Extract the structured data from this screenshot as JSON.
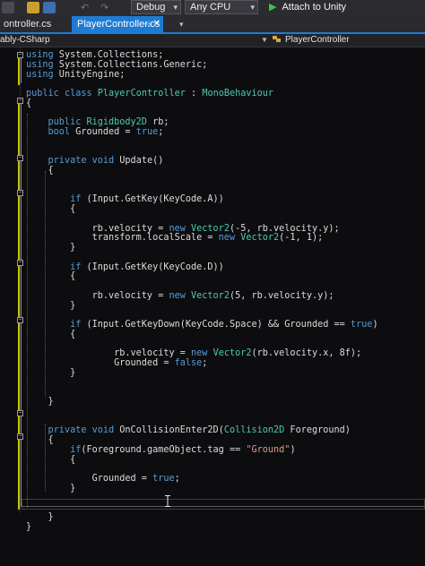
{
  "toolbar": {
    "config_combo": "Debug",
    "platform_combo": "Any CPU",
    "attach_label": "Attach to Unity",
    "icons": [
      "save-all-icon",
      "undo-icon",
      "redo-icon",
      "play-icon"
    ]
  },
  "tabs": [
    {
      "label": "ontroller.cs",
      "active": false
    },
    {
      "label": "PlayerController.cs",
      "active": true
    }
  ],
  "navbar": {
    "project": "ably-CSharp",
    "class_member": "PlayerController"
  },
  "code": {
    "lines": [
      [
        {
          "t": "using",
          "c": "kw"
        },
        {
          "t": " System.Collections;",
          "c": ""
        }
      ],
      [
        {
          "t": "using",
          "c": "kw"
        },
        {
          "t": " System.Collections.Generic;",
          "c": ""
        }
      ],
      [
        {
          "t": "using",
          "c": "kw"
        },
        {
          "t": " UnityEngine;",
          "c": ""
        }
      ],
      [],
      [
        {
          "t": "public",
          "c": "kw"
        },
        {
          "t": " ",
          "c": ""
        },
        {
          "t": "class",
          "c": "kw"
        },
        {
          "t": " ",
          "c": ""
        },
        {
          "t": "PlayerController",
          "c": "ty"
        },
        {
          "t": " : ",
          "c": ""
        },
        {
          "t": "MonoBehaviour",
          "c": "ty"
        }
      ],
      [
        {
          "t": "{",
          "c": ""
        }
      ],
      [],
      [
        {
          "t": "    public ",
          "c": "kw"
        },
        {
          "t": "Rigidbody2D",
          "c": "ty"
        },
        {
          "t": " rb;",
          "c": ""
        }
      ],
      [
        {
          "t": "    bool",
          "c": "kw"
        },
        {
          "t": " Grounded = ",
          "c": ""
        },
        {
          "t": "true",
          "c": "kw"
        },
        {
          "t": ";",
          "c": ""
        }
      ],
      [],
      [],
      [
        {
          "t": "    private ",
          "c": "kw"
        },
        {
          "t": "void",
          "c": "kw"
        },
        {
          "t": " Update()",
          "c": ""
        }
      ],
      [
        {
          "t": "    {",
          "c": ""
        }
      ],
      [],
      [],
      [
        {
          "t": "        if",
          "c": "kw"
        },
        {
          "t": " (Input.GetKey(KeyCode.A))",
          "c": ""
        }
      ],
      [
        {
          "t": "        {",
          "c": ""
        }
      ],
      [],
      [
        {
          "t": "            rb.velocity = ",
          "c": ""
        },
        {
          "t": "new",
          "c": "kw"
        },
        {
          "t": " ",
          "c": ""
        },
        {
          "t": "Vector2",
          "c": "ty"
        },
        {
          "t": "(-5, rb.velocity.y);",
          "c": ""
        }
      ],
      [
        {
          "t": "            transform.localScale = ",
          "c": ""
        },
        {
          "t": "new",
          "c": "kw"
        },
        {
          "t": " ",
          "c": ""
        },
        {
          "t": "Vector2",
          "c": "ty"
        },
        {
          "t": "(-1, 1);",
          "c": ""
        }
      ],
      [
        {
          "t": "        }",
          "c": ""
        }
      ],
      [],
      [
        {
          "t": "        if",
          "c": "kw"
        },
        {
          "t": " (Input.GetKey(KeyCode.D))",
          "c": ""
        }
      ],
      [
        {
          "t": "        {",
          "c": ""
        }
      ],
      [],
      [
        {
          "t": "            rb.velocity = ",
          "c": ""
        },
        {
          "t": "new",
          "c": "kw"
        },
        {
          "t": " ",
          "c": ""
        },
        {
          "t": "Vector2",
          "c": "ty"
        },
        {
          "t": "(5, rb.velocity.y);",
          "c": ""
        }
      ],
      [
        {
          "t": "        }",
          "c": ""
        }
      ],
      [],
      [
        {
          "t": "        if",
          "c": "kw"
        },
        {
          "t": " (Input.GetKeyDown(KeyCode.Space) && Grounded == ",
          "c": ""
        },
        {
          "t": "true",
          "c": "kw"
        },
        {
          "t": ")",
          "c": ""
        }
      ],
      [
        {
          "t": "        {",
          "c": ""
        }
      ],
      [],
      [
        {
          "t": "                rb.velocity = ",
          "c": ""
        },
        {
          "t": "new",
          "c": "kw"
        },
        {
          "t": " ",
          "c": ""
        },
        {
          "t": "Vector2",
          "c": "ty"
        },
        {
          "t": "(rb.velocity.x, 8f);",
          "c": ""
        }
      ],
      [
        {
          "t": "                Grounded = ",
          "c": ""
        },
        {
          "t": "false",
          "c": "kw"
        },
        {
          "t": ";",
          "c": ""
        }
      ],
      [
        {
          "t": "        }",
          "c": ""
        }
      ],
      [],
      [],
      [
        {
          "t": "    }",
          "c": ""
        }
      ],
      [],
      [],
      [
        {
          "t": "    private ",
          "c": "kw"
        },
        {
          "t": "void",
          "c": "kw"
        },
        {
          "t": " OnCollisionEnter2D(",
          "c": ""
        },
        {
          "t": "Collision2D",
          "c": "ty"
        },
        {
          "t": " Foreground)",
          "c": ""
        }
      ],
      [
        {
          "t": "    {",
          "c": ""
        }
      ],
      [
        {
          "t": "        if",
          "c": "kw"
        },
        {
          "t": "(Foreground.gameObject.tag == ",
          "c": ""
        },
        {
          "t": "\"Ground\"",
          "c": "st"
        },
        {
          "t": ")",
          "c": ""
        }
      ],
      [
        {
          "t": "        {",
          "c": ""
        }
      ],
      [],
      [
        {
          "t": "            Grounded = ",
          "c": ""
        },
        {
          "t": "true",
          "c": "kw"
        },
        {
          "t": ";",
          "c": ""
        }
      ],
      [
        {
          "t": "        }",
          "c": ""
        }
      ],
      [],
      [],
      [
        {
          "t": "    }",
          "c": ""
        }
      ],
      [
        {
          "t": "}",
          "c": ""
        }
      ]
    ]
  },
  "colors": {
    "accent": "#1f7bd2",
    "keyword": "#569cd6",
    "type": "#4ec9b0",
    "string": "#d69d85",
    "text": "#dcdcdc",
    "editor_bg": "#0d0d10"
  }
}
